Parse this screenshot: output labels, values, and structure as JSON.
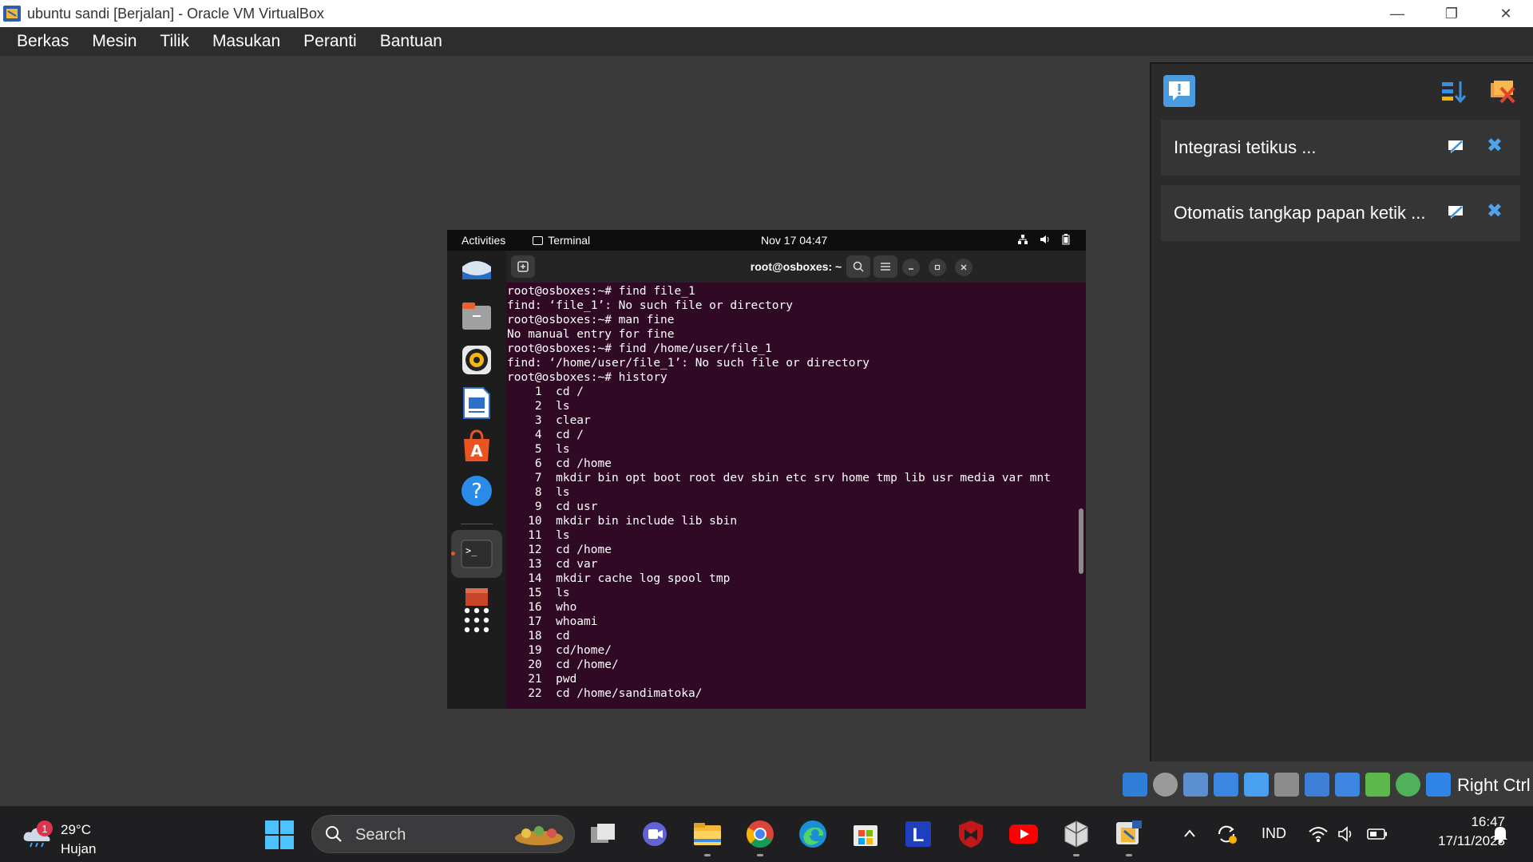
{
  "window": {
    "title": "ubuntu sandi [Berjalan] - Oracle VM VirtualBox",
    "controls": {
      "minimize": "—",
      "restore": "❐",
      "close": "✕"
    }
  },
  "menu": [
    "Berkas",
    "Mesin",
    "Tilik",
    "Masukan",
    "Peranti",
    "Bantuan"
  ],
  "guest": {
    "topbar": {
      "activities": "Activities",
      "app": "Terminal",
      "clock": "Nov 17  04:47"
    },
    "terminal": {
      "title": "root@osboxes: ~",
      "lines": [
        "root@osboxes:~# find file_1",
        "find: ‘file_1’: No such file or directory",
        "root@osboxes:~# man fine",
        "No manual entry for fine",
        "root@osboxes:~# find /home/user/file_1",
        "find: ‘/home/user/file_1’: No such file or directory",
        "root@osboxes:~# history",
        "    1  cd /",
        "    2  ls",
        "    3  clear",
        "    4  cd /",
        "    5  ls",
        "    6  cd /home",
        "    7  mkdir bin opt boot root dev sbin etc srv home tmp lib usr media var mnt",
        "    8  ls",
        "    9  cd usr",
        "   10  mkdir bin include lib sbin",
        "   11  ls",
        "   12  cd /home",
        "   13  cd var",
        "   14  mkdir cache log spool tmp",
        "   15  ls",
        "   16  who",
        "   17  whoami",
        "   18  cd",
        "   19  cd/home/",
        "   20  cd /home/",
        "   21  pwd",
        "   22  cd /home/sandimatoka/"
      ]
    }
  },
  "notifications": [
    {
      "text": "Integrasi tetikus ..."
    },
    {
      "text": "Otomatis tangkap papan ketik ..."
    }
  ],
  "statusbar": {
    "hostkey": "Right Ctrl"
  },
  "taskbar": {
    "weather": {
      "badge": "1",
      "temp": "29°C",
      "condition": "Hujan"
    },
    "search_label": "Search",
    "lang": "IND",
    "time": "16:47",
    "date": "17/11/2023"
  }
}
